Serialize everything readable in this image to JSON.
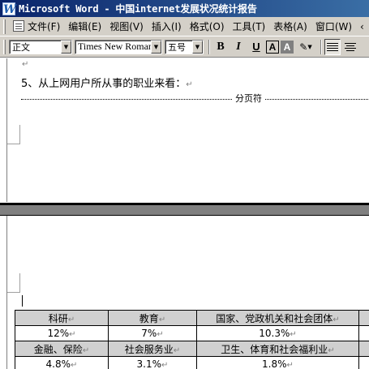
{
  "window": {
    "title": "Microsoft Word - 中国internet发展状况统计报告"
  },
  "menu": {
    "items": [
      "文件(F)",
      "编辑(E)",
      "视图(V)",
      "插入(I)",
      "格式(O)",
      "工具(T)",
      "表格(A)",
      "窗口(W)"
    ],
    "more": "‹"
  },
  "toolbar": {
    "style_value": "正文",
    "font_value": "Times New Roman",
    "size_value": "五号",
    "bold_label": "B",
    "italic_label": "I",
    "underline_label": "U",
    "border_label": "A",
    "shade_label": "A",
    "highlight_label": "✎"
  },
  "document": {
    "para_mark": "↵",
    "heading": "5、从上网用户所从事的职业来看：",
    "page_break_label": "分页符",
    "table": {
      "rows": [
        {
          "type": "hdr",
          "cells": [
            "科研",
            "教育",
            "国家、党政机关和社会团体"
          ]
        },
        {
          "type": "val",
          "cells": [
            "12%",
            "7%",
            "10.3%"
          ]
        },
        {
          "type": "hdr",
          "cells": [
            "金融、保险",
            "社会服务业",
            "卫生、体育和社会福利业"
          ]
        },
        {
          "type": "val",
          "cells": [
            "4.8%",
            "3.1%",
            "1.8%"
          ]
        }
      ]
    }
  },
  "colors": {
    "titlebar_start": "#0a246a",
    "titlebar_end": "#3a6ea5",
    "chrome": "#d4d0c8",
    "table_header_shade": "#d0d0d0"
  }
}
